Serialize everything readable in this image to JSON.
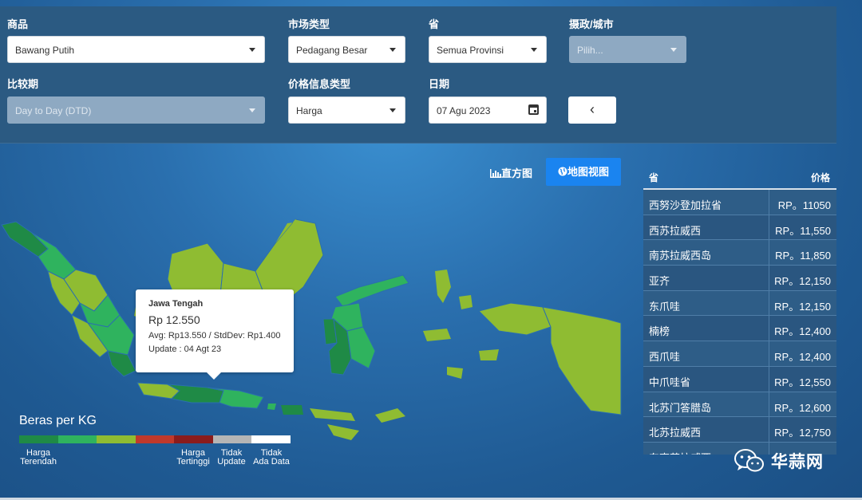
{
  "filters": {
    "commodity": {
      "label": "商品",
      "value": "Bawang Putih"
    },
    "market_type": {
      "label": "市场类型",
      "value": "Pedagang Besar"
    },
    "province": {
      "label": "省",
      "value": "Semua Provinsi"
    },
    "regency": {
      "label": "摄政/城市",
      "placeholder": "Pilih..."
    },
    "comparison": {
      "label": "比较期",
      "value": "Day to Day (DTD)"
    },
    "price_info": {
      "label": "价格信息类型",
      "value": "Harga"
    },
    "date": {
      "label": "日期",
      "value": "07 Agu 2023"
    },
    "back_symbol": "‹"
  },
  "views": {
    "histogram": "直方图",
    "map": "地图视图"
  },
  "tooltip": {
    "region": "Jawa Tengah",
    "price": "Rp 12.550",
    "stats": "Avg: Rp13.550 / StdDev: Rp1.400",
    "update": "Update : 04 Agt 23"
  },
  "legend": {
    "title": "Beras per KG",
    "colors": [
      "#1f8a46",
      "#2fb35e",
      "#8fbc32",
      "#c0392b",
      "#8a1c1c",
      "#b5b5b5",
      "#ffffff"
    ],
    "labels": [
      {
        "text": "Harga\nTerendah"
      },
      {
        "text": "Harga\nTertinggi"
      },
      {
        "text": "Tidak\nUpdate"
      },
      {
        "text": "Tidak\nAda Data"
      }
    ]
  },
  "table": {
    "headers": {
      "province": "省",
      "price": "价格"
    },
    "rows": [
      {
        "province": "西努沙登加拉省",
        "price": "RP。11050"
      },
      {
        "province": "西苏拉威西",
        "price": "RP。11,550"
      },
      {
        "province": "南苏拉威西岛",
        "price": "RP。11,850"
      },
      {
        "province": "亚齐",
        "price": "RP。12,150"
      },
      {
        "province": "东爪哇",
        "price": "RP。12,150"
      },
      {
        "province": "楠榜",
        "price": "RP。12,400"
      },
      {
        "province": "西爪哇",
        "price": "RP。12,400"
      },
      {
        "province": "中爪哇省",
        "price": "RP。12,550"
      },
      {
        "province": "北苏门答腊岛",
        "price": "RP。12,600"
      },
      {
        "province": "北苏拉威西",
        "price": "RP。12,750"
      },
      {
        "province": "东南苏拉威西",
        "price": ""
      }
    ]
  },
  "watermark": {
    "text": "华蒜网",
    "icon": "wechat-icon"
  }
}
